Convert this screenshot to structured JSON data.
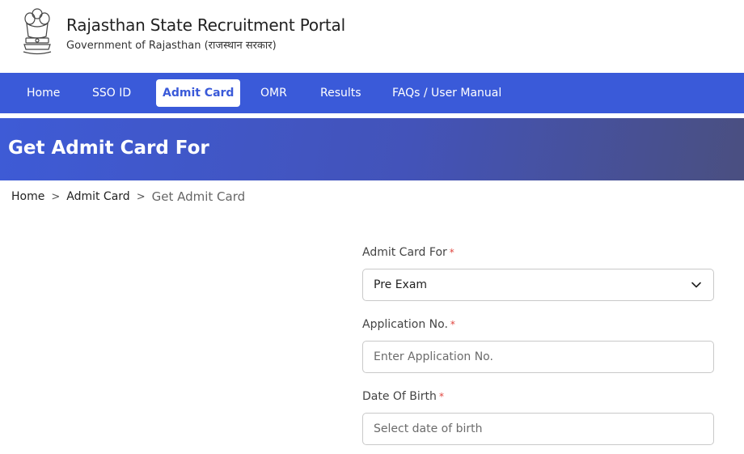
{
  "header": {
    "title": "Rajasthan State Recruitment Portal",
    "subtitle": "Government of Rajasthan (राजस्थान सरकार)",
    "emblem_icon": "national-emblem-icon"
  },
  "nav": {
    "items": [
      {
        "label": "Home"
      },
      {
        "label": "SSO ID"
      },
      {
        "label": "Admit Card",
        "active": true
      },
      {
        "label": "OMR"
      },
      {
        "label": "Results"
      },
      {
        "label": "FAQs / User Manual"
      }
    ]
  },
  "banner": {
    "title": "Get Admit Card For"
  },
  "breadcrumb": {
    "home": "Home",
    "separator": ">",
    "section": "Admit Card",
    "current": "Get Admit Card"
  },
  "form": {
    "admit_card_for": {
      "label": "Admit Card For",
      "required": "*",
      "value": "Pre Exam"
    },
    "application_no": {
      "label": "Application No.",
      "required": "*",
      "placeholder": "Enter Application No."
    },
    "dob": {
      "label": "Date Of Birth",
      "required": "*",
      "placeholder": "Select date of birth"
    }
  },
  "colors": {
    "nav_bg": "#3a5ad9",
    "banner_start": "#3e5bd6",
    "banner_end": "#4a4f80",
    "required": "#e0463f"
  }
}
